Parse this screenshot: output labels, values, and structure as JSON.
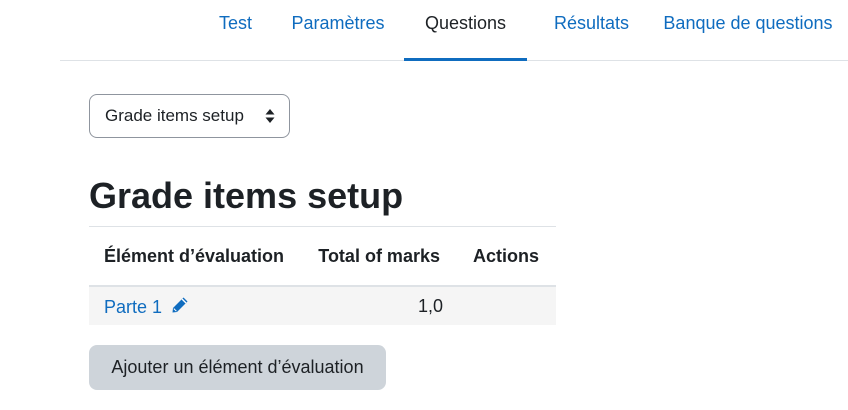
{
  "nav": {
    "tabs": [
      {
        "label": "Test",
        "active": false
      },
      {
        "label": "Paramètres",
        "active": false
      },
      {
        "label": "Questions",
        "active": true
      },
      {
        "label": "Résultats",
        "active": false
      },
      {
        "label": "Banque de questions",
        "active": false
      }
    ]
  },
  "select": {
    "selected": "Grade items setup"
  },
  "page_title": "Grade items setup",
  "table": {
    "headers": [
      "Élément d’évaluation",
      "Total of marks",
      "Actions"
    ],
    "rows": [
      {
        "item": "Parte 1",
        "total": "1,0",
        "actions": ""
      }
    ]
  },
  "add_button_label": "Ajouter un élément d’évaluation",
  "colors": {
    "link": "#0f6cbf",
    "text": "#1d2125",
    "button_bg": "#ced4da",
    "row_bg": "#f5f5f5"
  }
}
